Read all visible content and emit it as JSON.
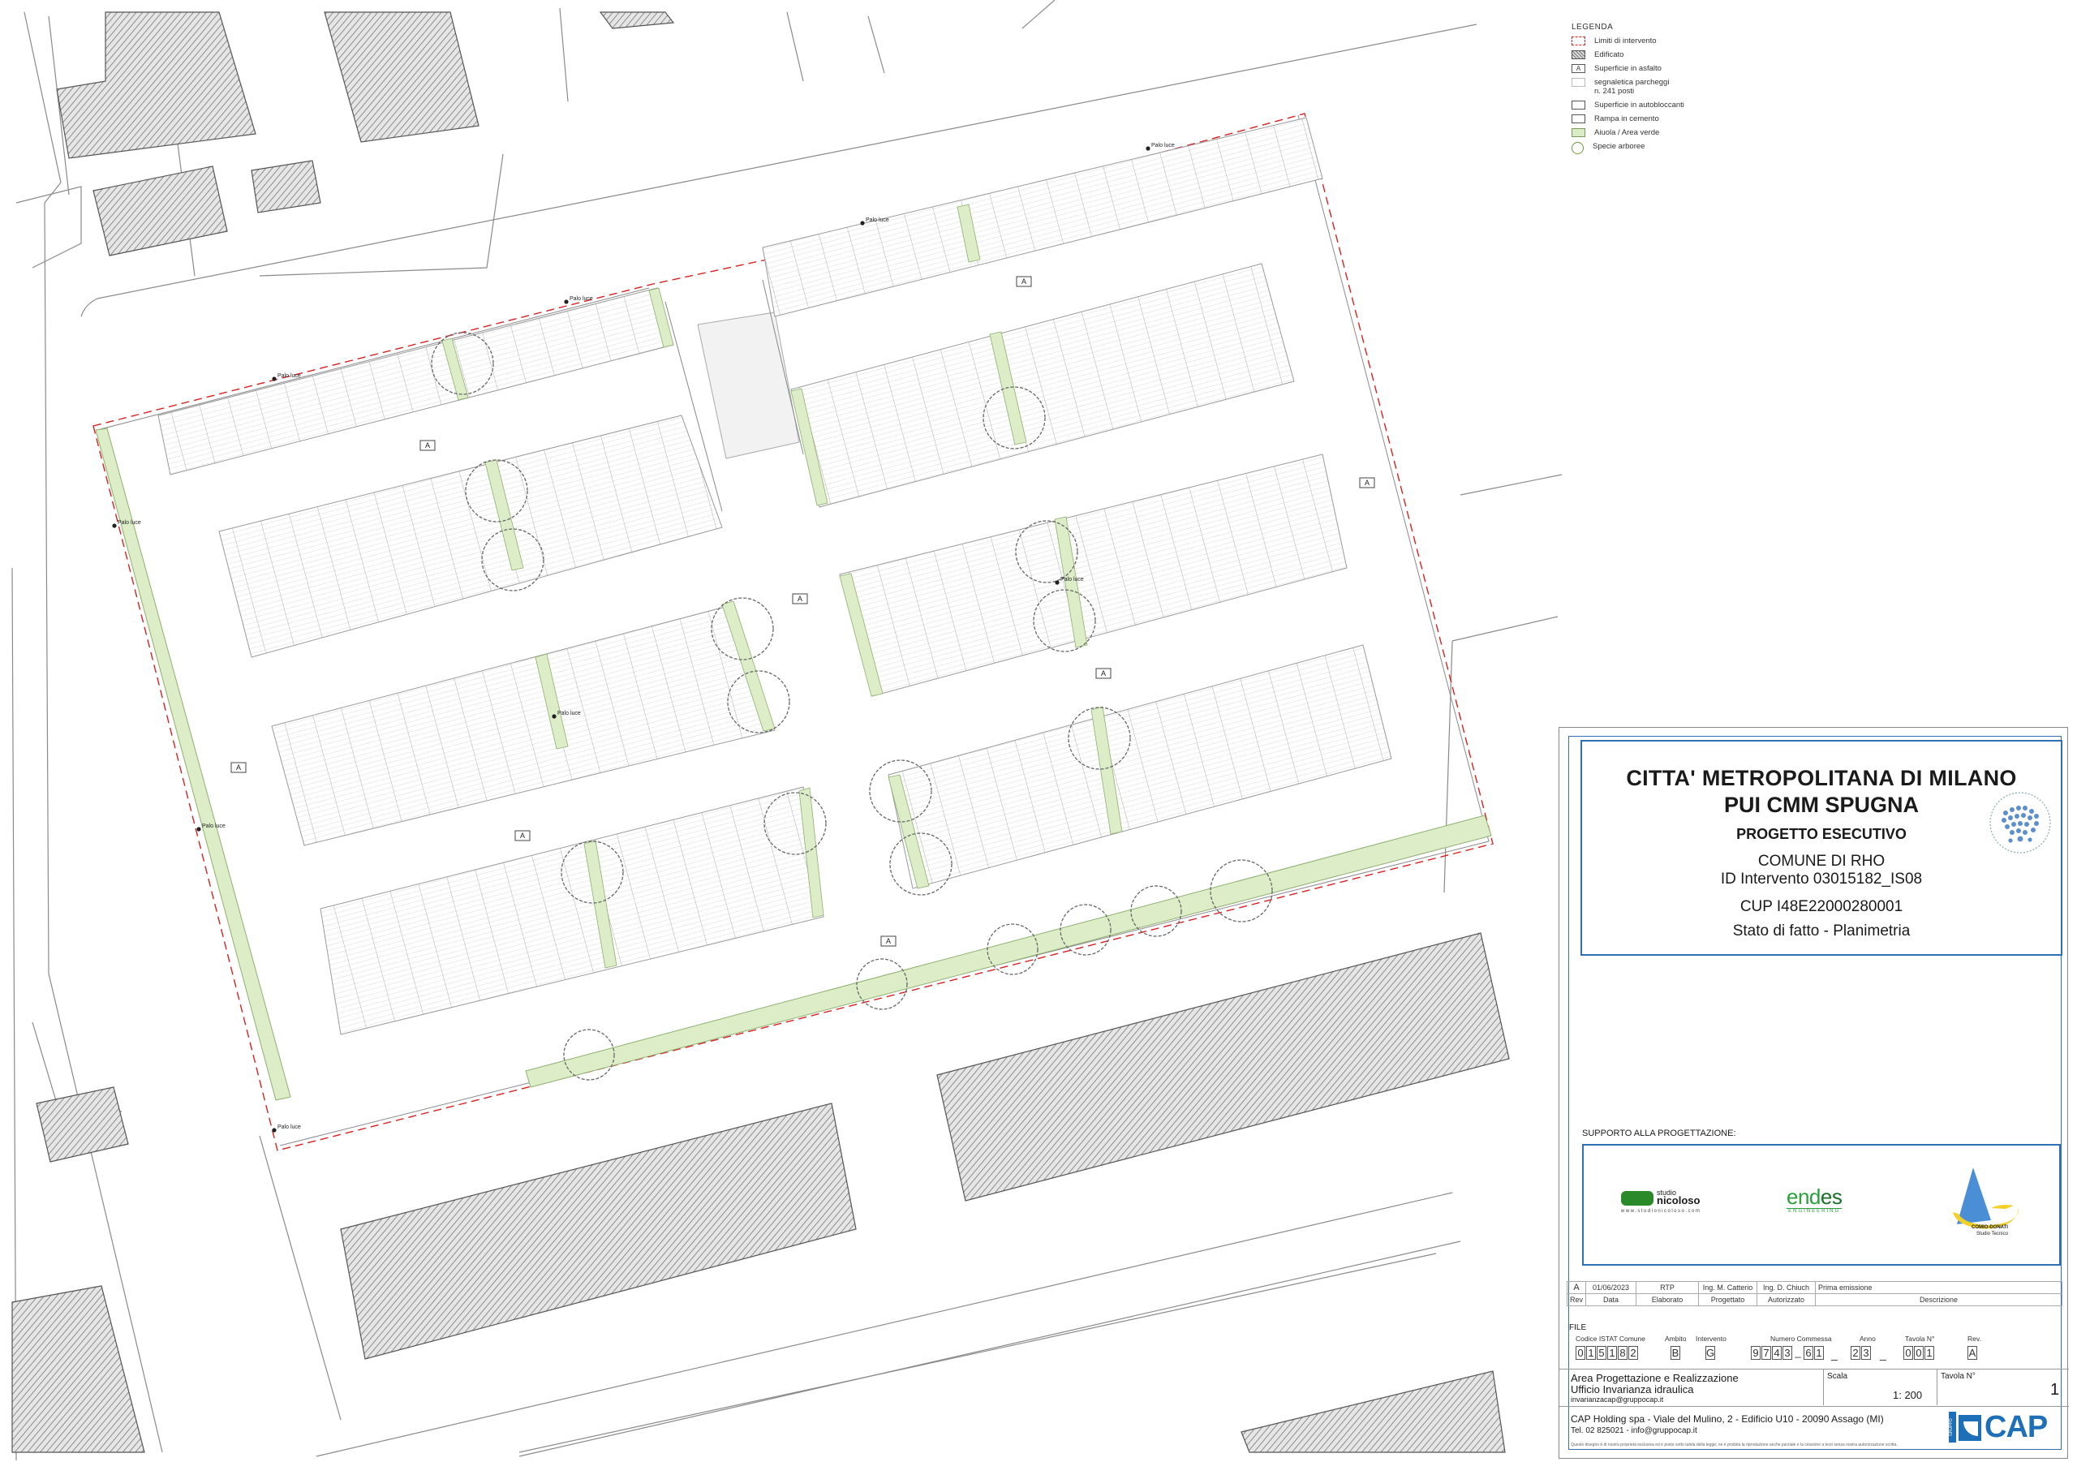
{
  "legend": {
    "title": "LEGENDA",
    "items": [
      {
        "label": "Limiti di intervento",
        "swatch": "red-dashed"
      },
      {
        "label": "Edificato",
        "swatch": "hatch"
      },
      {
        "label": "Superficie in asfalto",
        "swatch": "letter",
        "mark": "A"
      },
      {
        "label": "segnaletica parcheggi",
        "label2": "n. 241 posti",
        "swatch": "empty"
      },
      {
        "label": "Superficie in autobloccanti",
        "swatch": "empty"
      },
      {
        "label": "Rampa in cemento",
        "swatch": "empty"
      },
      {
        "label": "Aiuola / Area verde",
        "swatch": "green"
      },
      {
        "label": "Specie arboree",
        "swatch": "tree"
      }
    ]
  },
  "plan": {
    "asphalt_mark": "A",
    "light_label": "Palo luce",
    "colors": {
      "boundary": "#d62222",
      "green": "#dcedc8",
      "green_stroke": "#8fb070",
      "tree": "#666666",
      "hatch": "#7a7a7a",
      "line": "#8a8a8a"
    }
  },
  "titleblock": {
    "line1": "CITTA' METROPOLITANA DI MILANO",
    "line2": "PUI CMM SPUGNA",
    "line3": "PROGETTO ESECUTIVO",
    "line4": "COMUNE DI RHO",
    "line5": "ID Intervento 03015182_IS08",
    "line6": "CUP I48E22000280001",
    "line7": "Stato di fatto - Planimetria",
    "support_title": "SUPPORTO ALLA PROGETTAZIONE:",
    "logo1_small": "studio",
    "logo1_name": "nicoloso",
    "logo1_url": "www.studionicoloso.com",
    "logo2_name1": "end",
    "logo2_name2": "es",
    "logo2_sub": "ENGINEERING",
    "logo3_name": "COMIO-DONATI",
    "logo3_sub": "Studio Tecnico",
    "revision": {
      "rev": "A",
      "date": "01/06/2023",
      "elaborato": "RTP",
      "progettato": "Ing. M. Catterio",
      "autorizzato": "Ing. D. Chiuch",
      "descrizione": "Prima emissione",
      "h_rev": "Rev",
      "h_date": "Data",
      "h_elab": "Elaborato",
      "h_prog": "Progettato",
      "h_aut": "Autorizzato",
      "h_desc": "Descrizione"
    },
    "file_label": "FILE",
    "codes": {
      "istat_label": "Codice ISTAT Comune",
      "istat": "015182",
      "ambito_label": "Ambito",
      "ambito": "B",
      "intervento_label": "Intervento",
      "intervento": "G",
      "commessa_label": "Numero Commessa",
      "commessa": "9743_61",
      "anno_label": "Anno",
      "anno": "23",
      "tavola_label": "Tavola N°",
      "tavola": "001",
      "rev_label": "Rev.",
      "rev": "A"
    },
    "office1": "Area Progettazione e Realizzazione",
    "office2": "Ufficio Invarianza idraulica",
    "office_email": "invarianzacap@gruppocap.it",
    "scala_label": "Scala",
    "scala": "1: 200",
    "tavola_n_label": "Tavola N°",
    "tavola_n": "1",
    "company": "CAP Holding spa - Viale del Mulino, 2 - Edificio U10 - 20090 Assago (MI)",
    "company_contact": "Tel. 02 825021 - info@gruppocap.it",
    "disclaimer": "Questo disegno è di nostra proprietà esclusiva ed è posto sotto tutela della legge; ne è proibita la riproduzione anche parziale e la cessione a terzi senza nostra autorizzazione scritta.",
    "cap_brand": "CAP",
    "cap_group": "GRUPPO"
  }
}
